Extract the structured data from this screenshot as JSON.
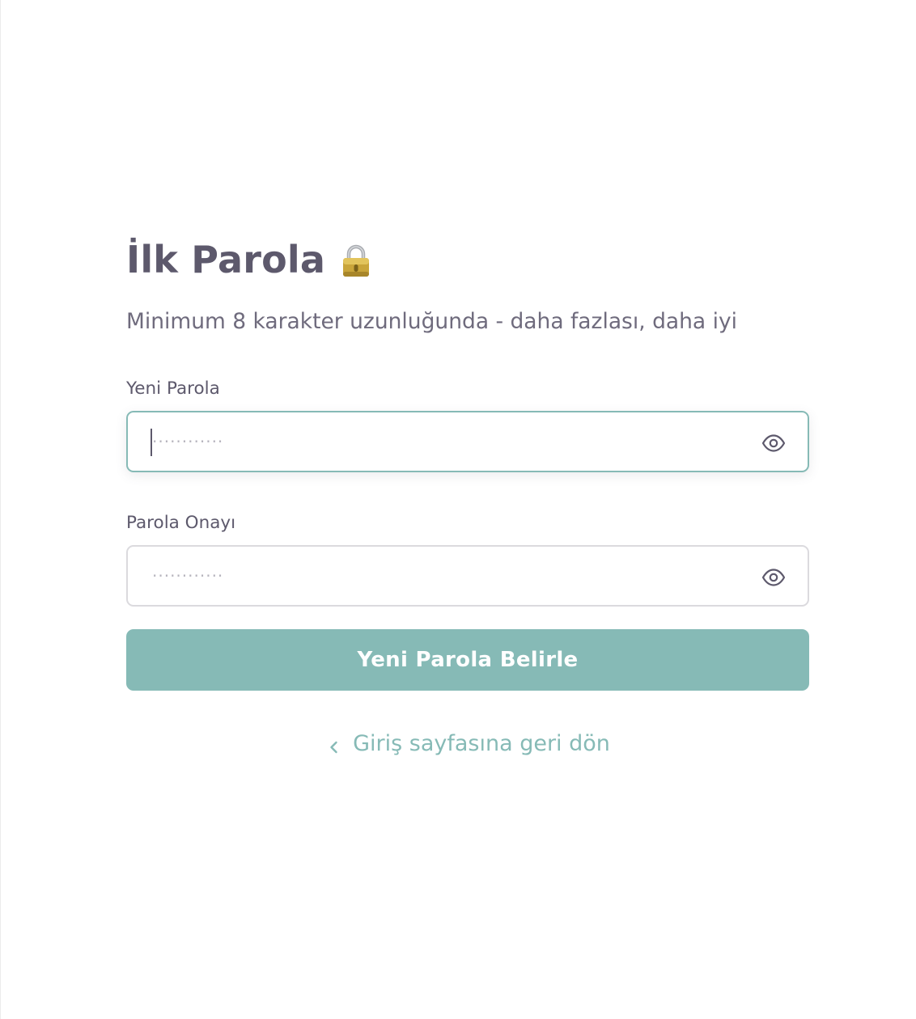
{
  "page": {
    "title": "İlk Parola",
    "subtitle": "Minimum 8 karakter uzunluğunda - daha fazlası, daha iyi",
    "icons": {
      "title": "lock-icon",
      "toggle_visibility": "eye-icon",
      "back": "chevron-left-icon"
    }
  },
  "form": {
    "new_password": {
      "label": "Yeni Parola",
      "placeholder": "············",
      "value": ""
    },
    "confirm_password": {
      "label": "Parola Onayı",
      "placeholder": "············",
      "value": ""
    },
    "submit_label": "Yeni Parola Belirle"
  },
  "back_link": {
    "label": "Giriş sayfasına geri dön"
  },
  "colors": {
    "accent": "#86bab6",
    "heading": "#5d596c",
    "body_text": "#6f6b7d",
    "border": "#dbdade"
  }
}
